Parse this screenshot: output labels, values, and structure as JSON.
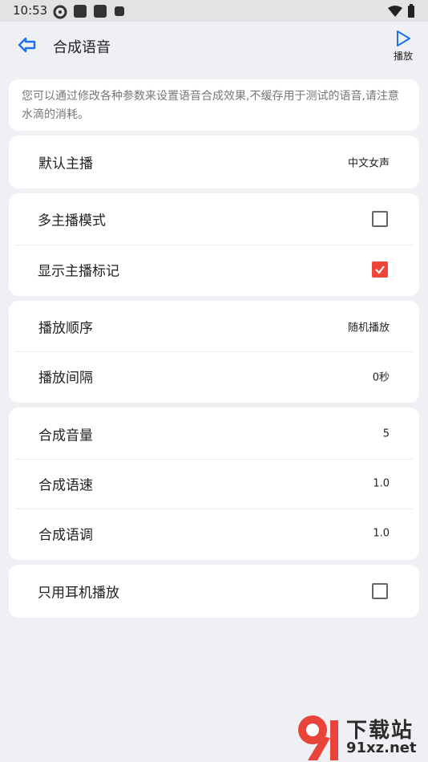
{
  "status_bar": {
    "time": "10:53",
    "notification_icons": [
      "settings-icon",
      "app-icon",
      "app-icon",
      "a-icon"
    ],
    "right_icons": [
      "wifi-icon",
      "battery-icon"
    ]
  },
  "header": {
    "title": "合成语音",
    "play_label": "播放"
  },
  "notice": "您可以通过修改各种参数来设置语音合成效果,不缓存用于测试的语音,请注意水滴的消耗。",
  "sections": {
    "anchor": {
      "label": "默认主播",
      "value": "中文女声"
    },
    "multi_anchor": {
      "label": "多主播模式",
      "checked": false
    },
    "show_anchor_mark": {
      "label": "显示主播标记",
      "checked": true
    },
    "play_order": {
      "label": "播放顺序",
      "value": "随机播放"
    },
    "play_interval": {
      "label": "播放间隔",
      "value": "0秒"
    },
    "volume": {
      "label": "合成音量",
      "value": "5"
    },
    "speed": {
      "label": "合成语速",
      "value": "1.0"
    },
    "pitch": {
      "label": "合成语调",
      "value": "1.0"
    },
    "headphone_only": {
      "label": "只用耳机播放",
      "checked": false
    }
  },
  "watermark": {
    "cn": "下载站",
    "en": "91xz.net"
  },
  "colors": {
    "accent": "#1a73e8",
    "checked": "#f04438",
    "background": "#eff0f4"
  }
}
